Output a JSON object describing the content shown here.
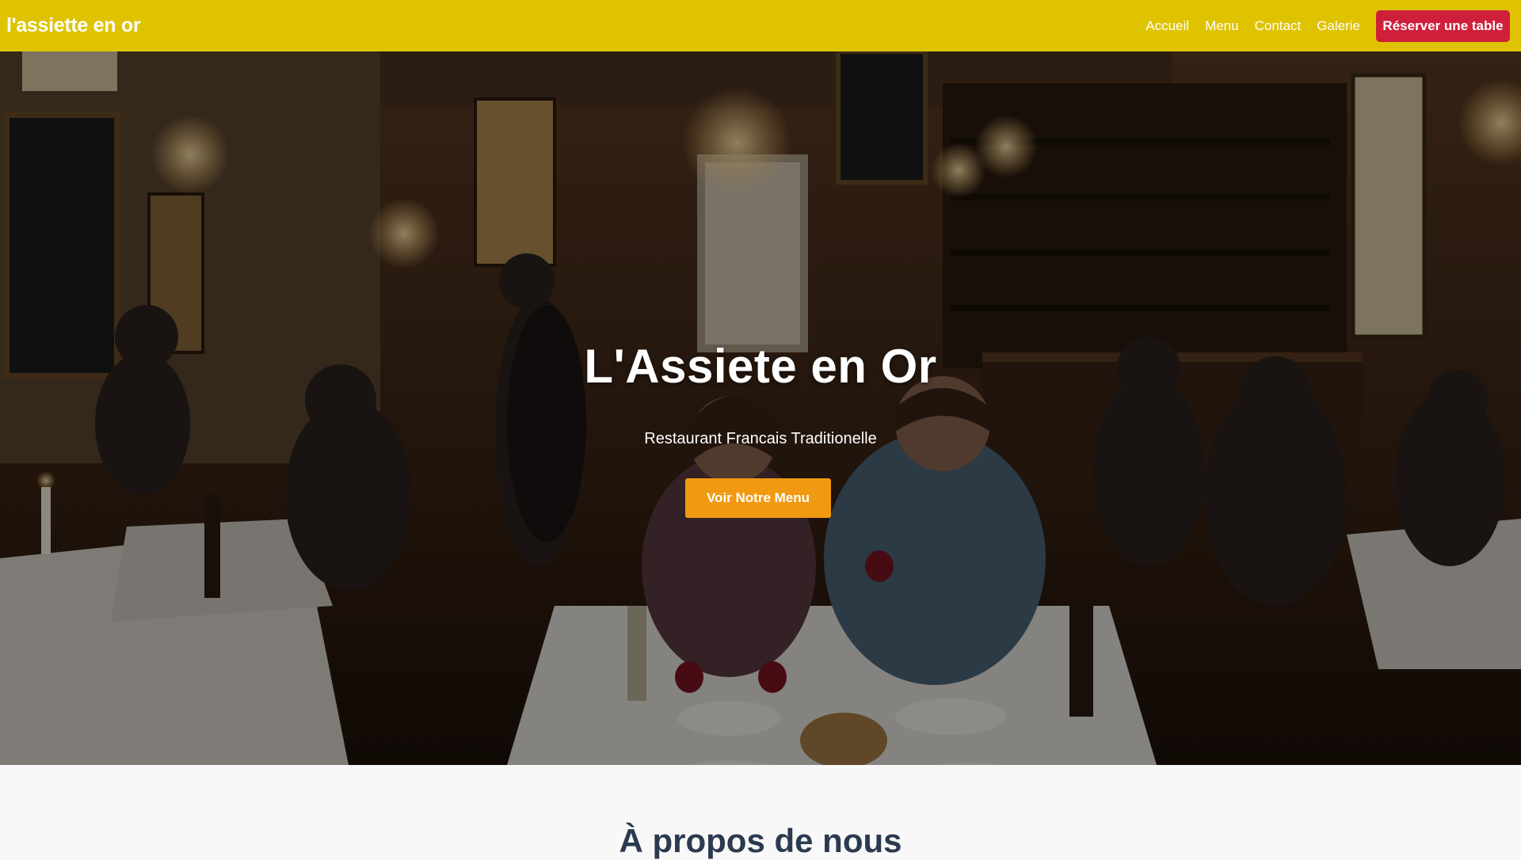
{
  "navbar": {
    "brand": "l'assiette en or",
    "links": [
      "Accueil",
      "Menu",
      "Contact",
      "Galerie"
    ],
    "reserve_label": "Réserver une table",
    "bg_color": "#dfc300",
    "reserve_color": "#cf1f3a"
  },
  "hero": {
    "title": "L'Assiete en Or",
    "subtitle": "Restaurant Francais Traditionelle",
    "cta_label": "Voir Notre Menu",
    "cta_color": "#f09a12",
    "image": "restaurant-interior-photo"
  },
  "about": {
    "title": "À propos de nous"
  }
}
